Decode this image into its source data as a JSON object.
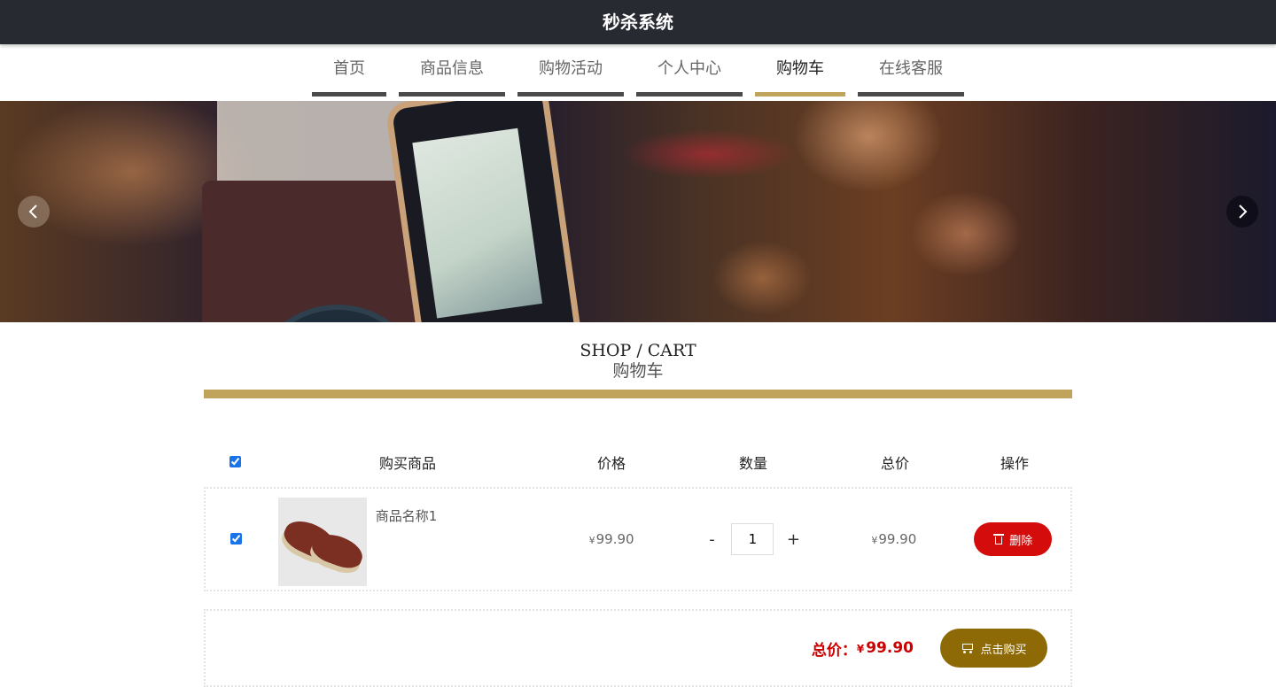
{
  "header": {
    "title": "秒杀系统"
  },
  "nav": {
    "items": [
      {
        "label": "首页"
      },
      {
        "label": "商品信息"
      },
      {
        "label": "购物活动"
      },
      {
        "label": "个人中心"
      },
      {
        "label": "购物车",
        "active": true
      },
      {
        "label": "在线客服"
      }
    ],
    "active_color": "#c1a45c",
    "inactive_color": "#4a4a4a"
  },
  "banner": {
    "prev_icon": "chevron-left-icon",
    "next_icon": "chevron-right-icon"
  },
  "section": {
    "title_en": "SHOP / CART",
    "title_cn": "购物车"
  },
  "cart": {
    "columns": {
      "goods": "购买商品",
      "price": "价格",
      "quantity": "数量",
      "total": "总价",
      "operation": "操作"
    },
    "select_all_checked": true,
    "items": [
      {
        "checked": true,
        "name": "商品名称1",
        "currency": "¥",
        "price": "99.90",
        "quantity": "1",
        "qty_minus": "-",
        "qty_plus": "+",
        "total": "99.90",
        "delete_label": "删除"
      }
    ],
    "summary": {
      "total_label": "总价：",
      "currency": "¥",
      "total_value": "99.90",
      "buy_label": "点击购买"
    },
    "colors": {
      "delete": "#d40c0c",
      "buy": "#8e6a07",
      "total_text": "#cc0000"
    }
  }
}
